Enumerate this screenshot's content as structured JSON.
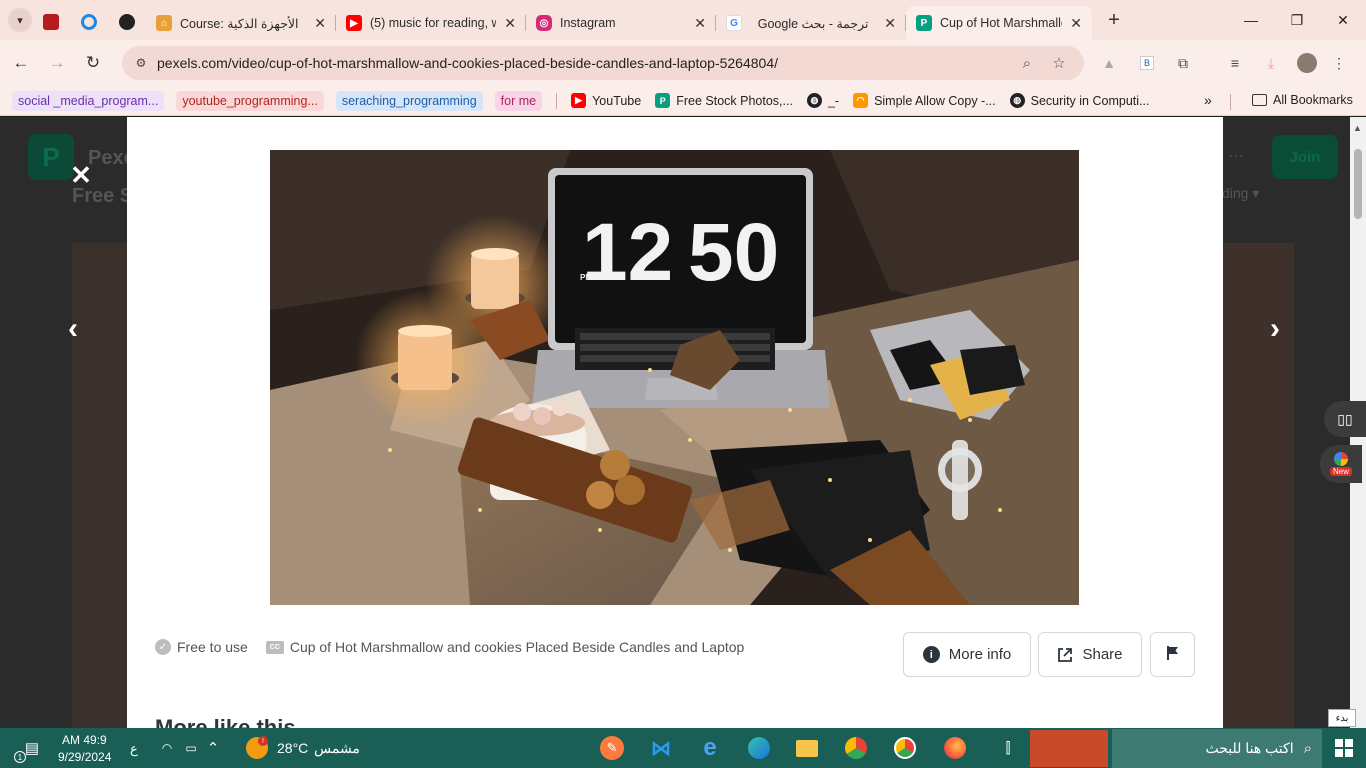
{
  "browser": {
    "tabs": [
      {
        "title": "",
        "favicon": "red",
        "pinned": true
      },
      {
        "title": "",
        "favicon": "#1e88e5",
        "pinned": true
      },
      {
        "title": "",
        "favicon": "#222",
        "pinned": true
      },
      {
        "title": "Course: الأجهزة الذكية",
        "favicon": "#e8a13a",
        "close": "✕"
      },
      {
        "title": "(5) music for reading, w",
        "favicon": "#ff0000",
        "close": "✕"
      },
      {
        "title": "Instagram",
        "favicon": "#d62976",
        "close": "✕"
      },
      {
        "title": "ترجمة - بحث Google",
        "favicon": "#4285f4",
        "close": "✕"
      },
      {
        "title": "Cup of Hot Marshmallo",
        "favicon": "#05a081",
        "close": "✕"
      }
    ],
    "new_tab": "+",
    "window": {
      "minimize": "—",
      "restore": "❐",
      "close": "✕"
    },
    "url": "pexels.com/video/cup-of-hot-marshmallow-and-cookies-placed-beside-candles-and-laptop-5264804/",
    "bookmarks": [
      {
        "label": "social _media_program...",
        "bg": "#ece1f7",
        "color": "#6b2fb3"
      },
      {
        "label": "youtube_programming...",
        "bg": "#f8d8d8",
        "color": "#b3261e"
      },
      {
        "label": "seraching_programming",
        "bg": "#d6e6f8",
        "color": "#1e5fa8"
      },
      {
        "label": "for me",
        "bg": "#f7d5e6",
        "color": "#b0245d"
      }
    ],
    "bookmark_links": [
      {
        "label": "YouTube",
        "icon": "#ff0000"
      },
      {
        "label": "Free Stock Photos,...",
        "icon": "#05a081"
      },
      {
        "label": "_-",
        "icon": "#222"
      },
      {
        "label": "Simple Allow Copy -...",
        "icon": "#ff9800"
      },
      {
        "label": "Security in Computi...",
        "icon": "#222"
      }
    ],
    "more_bookmarks": "»",
    "all_bookmarks": "All Bookmarks"
  },
  "background_page": {
    "logo": "P",
    "brand": "Pexe",
    "heading": "Free S",
    "join": "Join",
    "sort": "ding ▾",
    "menu": "···"
  },
  "modal": {
    "close": "✕",
    "prev": "‹",
    "next": "›",
    "laptop_clock": {
      "hour": "12",
      "minute": "50",
      "meridiem": "PM"
    },
    "free_to_use": "Free to use",
    "caption": "Cup of Hot Marshmallow and cookies Placed Beside Candles and Laptop",
    "more_info": "More info",
    "share": "Share",
    "next_section": "More like this"
  },
  "sidebar_widget": {
    "new_badge": "New"
  },
  "taskbar": {
    "search_placeholder": "اكتب هنا للبحث",
    "weather_temp": "28°C",
    "weather_desc": "مشمس",
    "time": "AM 49:9",
    "date": "9/29/2024",
    "lang": "ع",
    "notif_count": "1",
    "lang_tooltip": "بدء"
  },
  "colors": {
    "tabbar": "#f8e4df",
    "toolbar": "#fbeeea",
    "taskbar": "#1a5f56",
    "pexels_green": "#05a081"
  }
}
